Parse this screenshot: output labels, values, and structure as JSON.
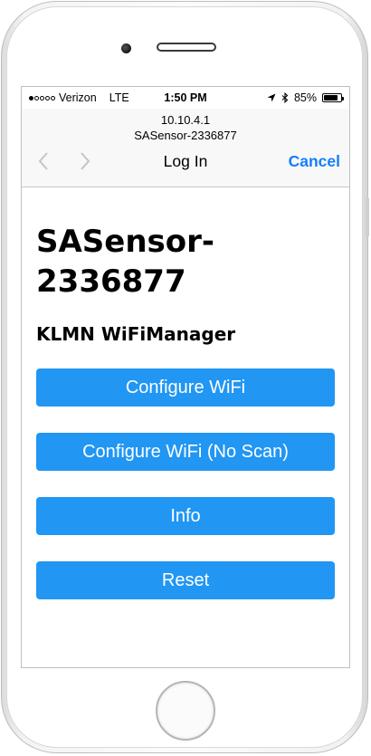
{
  "status_bar": {
    "signal_dots": [
      true,
      false,
      false,
      false,
      false
    ],
    "carrier": "Verizon",
    "network": "LTE",
    "time": "1:50 PM",
    "battery": "85%",
    "battery_level": 0.85
  },
  "browser": {
    "ip": "10.10.4.1",
    "host": "SASensor-2336877",
    "title": "Log In",
    "cancel_label": "Cancel"
  },
  "page": {
    "title": "SASensor-2336877",
    "subtitle": "KLMN WiFiManager",
    "buttons": [
      {
        "label": "Configure WiFi"
      },
      {
        "label": "Configure WiFi (No Scan)"
      },
      {
        "label": "Info"
      },
      {
        "label": "Reset"
      }
    ]
  },
  "colors": {
    "button_bg": "#2196f3",
    "link_blue": "#157efb",
    "nav_bg": "#f8f8f8"
  }
}
